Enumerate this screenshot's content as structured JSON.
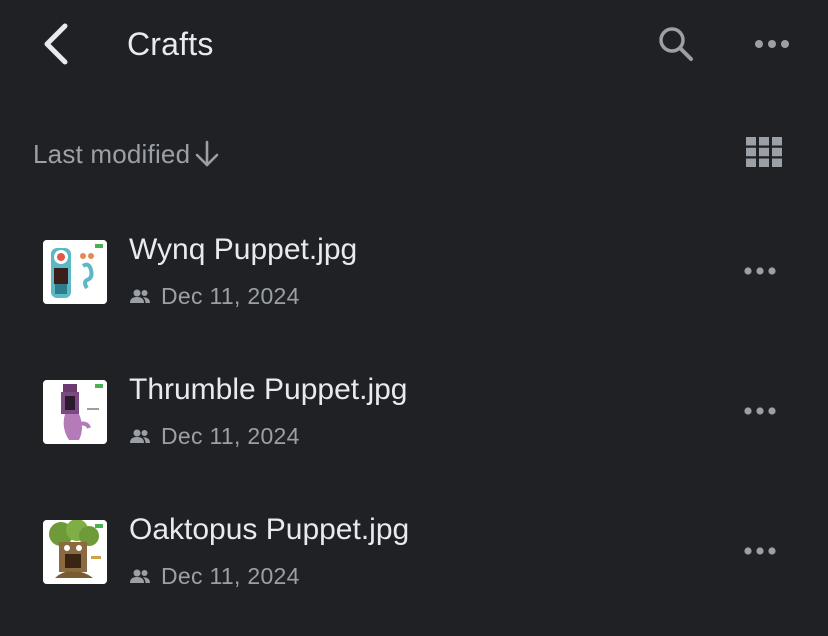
{
  "header": {
    "title": "Crafts",
    "back_icon": "chevron-left-icon",
    "search_icon": "search-icon",
    "more_icon": "more-horizontal-icon"
  },
  "sort": {
    "label": "Last modified",
    "direction_icon": "arrow-down-icon",
    "view_toggle_icon": "grid-view-icon"
  },
  "files": [
    {
      "name": "Wynq Puppet.jpg",
      "date": "Dec 11, 2024",
      "shared_icon": "people-icon"
    },
    {
      "name": "Thrumble Puppet.jpg",
      "date": "Dec 11, 2024",
      "shared_icon": "people-icon"
    },
    {
      "name": "Oaktopus Puppet.jpg",
      "date": "Dec 11, 2024",
      "shared_icon": "people-icon"
    }
  ],
  "colors": {
    "background": "#202124",
    "primary_text": "#e8eaed",
    "secondary_text": "#9aa0a6"
  }
}
